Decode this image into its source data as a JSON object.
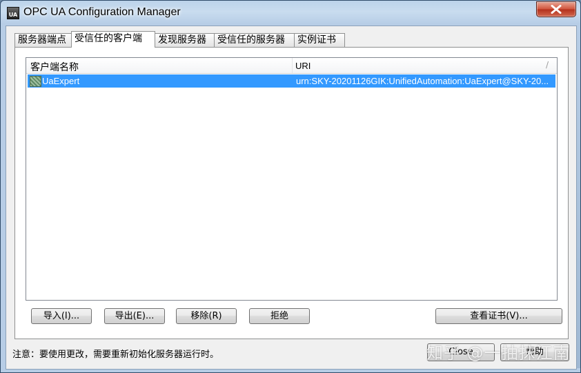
{
  "window": {
    "title": "OPC UA Configuration Manager",
    "icon_label": "UA"
  },
  "tabs": [
    {
      "label": "服务器端点",
      "active": false
    },
    {
      "label": "受信任的客户端",
      "active": true
    },
    {
      "label": "发现服务器",
      "active": false
    },
    {
      "label": "受信任的服务器",
      "active": false
    },
    {
      "label": "实例证书",
      "active": false
    }
  ],
  "list": {
    "columns": [
      "客户端名称",
      "URI"
    ],
    "sort_glyph": "/",
    "rows": [
      {
        "name": "UaExpert",
        "uri": "urn:SKY-20201126GIK:UnifiedAutomation:UaExpert@SKY-20..."
      }
    ]
  },
  "buttons": {
    "import": "导入(I)...",
    "export": "导出(E)...",
    "remove": "移除(R)",
    "reject": "拒绝",
    "view_cert": "查看证书(V)..."
  },
  "footer": {
    "note": "注意：要使用更改，需要重新初始化服务器运行时。",
    "close": "Close",
    "help": "帮助"
  },
  "watermark": "知乎 @一抽抹江南",
  "colors": {
    "selection": "#3399ff",
    "title_bar": "#c9dcef",
    "close_button": "#c8462d"
  }
}
